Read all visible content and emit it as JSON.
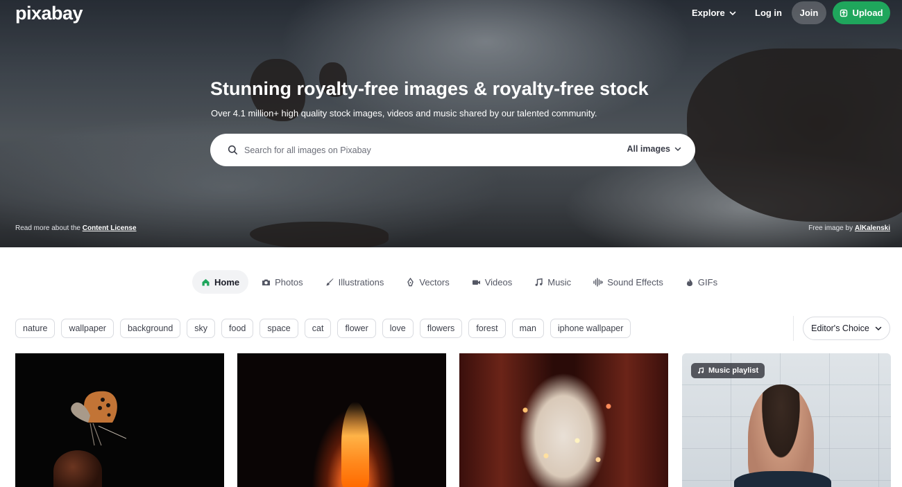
{
  "header": {
    "logo": "pixabay",
    "explore": "Explore",
    "login": "Log in",
    "join": "Join",
    "upload": "Upload"
  },
  "hero": {
    "title": "Stunning royalty-free images & royalty-free stock",
    "subtitle": "Over 4.1 million+ high quality stock images, videos and music shared by our talented community.",
    "search": {
      "placeholder": "Search for all images on Pixabay",
      "scope": "All images"
    },
    "license_prefix": "Read more about the",
    "license_link": "Content License",
    "credit_prefix": "Free image by",
    "credit_author": "AlKalenski"
  },
  "tabs": [
    {
      "label": "Home",
      "icon": "home-icon",
      "active": true
    },
    {
      "label": "Photos",
      "icon": "camera-icon"
    },
    {
      "label": "Illustrations",
      "icon": "brush-icon"
    },
    {
      "label": "Vectors",
      "icon": "pen-nib-icon"
    },
    {
      "label": "Videos",
      "icon": "video-camera-icon"
    },
    {
      "label": "Music",
      "icon": "music-note-icon"
    },
    {
      "label": "Sound Effects",
      "icon": "waveform-icon"
    },
    {
      "label": "GIFs",
      "icon": "gif-icon"
    }
  ],
  "tags": [
    "nature",
    "wallpaper",
    "background",
    "sky",
    "food",
    "space",
    "cat",
    "flower",
    "love",
    "flowers",
    "forest",
    "man",
    "iphone wallpaper"
  ],
  "sort": {
    "label": "Editor's Choice"
  },
  "grid": {
    "badge": "Music playlist"
  },
  "colors": {
    "accent": "#1fa65c",
    "text": "#191b26"
  }
}
